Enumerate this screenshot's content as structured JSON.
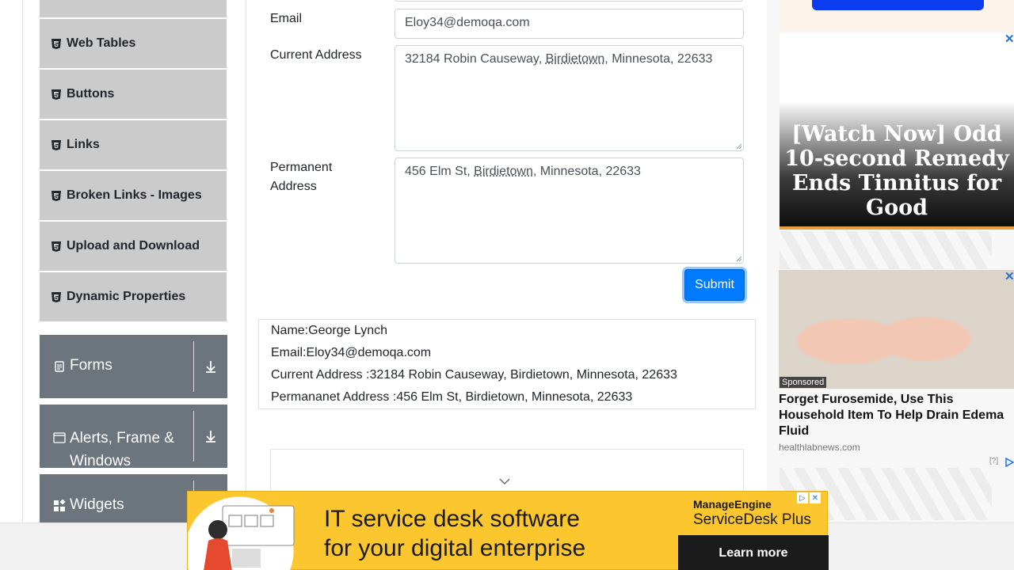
{
  "sidebar": {
    "items": [
      {
        "label": "Web Tables"
      },
      {
        "label": "Buttons"
      },
      {
        "label": "Links"
      },
      {
        "label": "Broken Links - Images"
      },
      {
        "label": "Upload and Download"
      },
      {
        "label": "Dynamic Properties"
      }
    ],
    "groups": [
      {
        "label": "Forms",
        "icon": "form-icon"
      },
      {
        "label": "Alerts, Frame & Windows",
        "icon": "window-icon"
      },
      {
        "label": "Widgets",
        "icon": "widgets-icon"
      }
    ]
  },
  "form": {
    "email_label": "Email",
    "email_value": "Eloy34@demoqa.com",
    "current_address_label": "Current Address",
    "current_address_prefix": "32184 Robin Causeway, ",
    "current_address_city": "Birdietown,",
    "current_address_suffix": " Minnesota, 22633",
    "permanent_address_label": "Permanent Address",
    "permanent_address_prefix": "456 Elm St, ",
    "permanent_address_city": "Birdietown",
    "permanent_address_suffix": ", Minnesota, 22633",
    "submit_label": "Submit"
  },
  "output": {
    "name": "Name:George Lynch",
    "email": "Email:Eloy34@demoqa.com",
    "current_address": "Current Address :32184 Robin Causeway, Birdietown, Minnesota, 22633",
    "permanent_address": "Permananet Address :456 Elm St, Birdietown, Minnesota, 22633"
  },
  "ads": {
    "right_top_headline": "[Watch Now] Odd 10-second Remedy Ends Tinnitus for Good",
    "sponsored_label": "Sponsored",
    "right_mid_title": "Forget Furosemide, Use This Household Item To Help Drain Edema Fluid",
    "right_mid_source": "healthlabnews.com",
    "right_mid_q": "[?]",
    "banner_headline_1": "IT service desk software",
    "banner_headline_2": "for your digital enterprise",
    "banner_brand_1": "ManageEngine",
    "banner_brand_2": "ServiceDesk Plus",
    "banner_cta": "Learn more"
  },
  "colors": {
    "submit": "#007bff",
    "group_bg": "#6c757d",
    "menu_item_bg": "#cbcbcb",
    "banner_bg": "#fcc62e"
  }
}
